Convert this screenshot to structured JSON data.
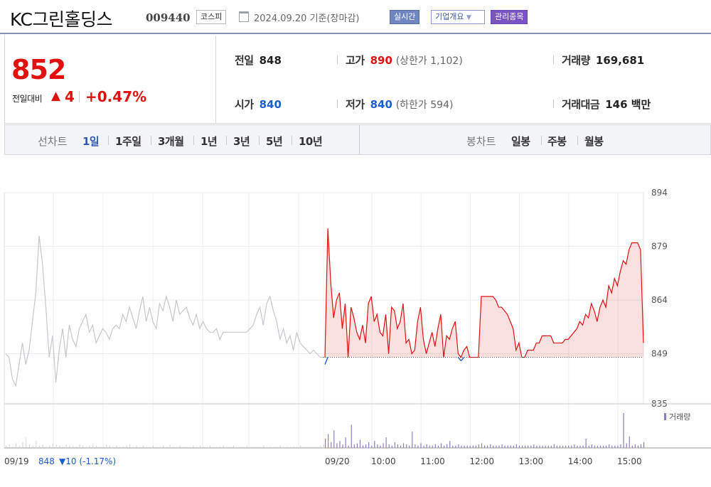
{
  "header": {
    "company_name": "KC그린홀딩스",
    "stock_code": "009440",
    "market": "코스피",
    "date_text": "2024.09.20 기준(장마감)",
    "realtime_label": "실시간",
    "company_info_label": "기업개요",
    "managed_label": "관리종목"
  },
  "quote": {
    "price": "852",
    "change_label": "전일대비",
    "change_value": "4",
    "change_pct": "+0.47%",
    "prev_close_label": "전일",
    "prev_close": "848",
    "high_label": "고가",
    "high": "890",
    "upper_limit": "(상한가 1,102)",
    "volume_label": "거래량",
    "volume": "169,681",
    "open_label": "시가",
    "open": "840",
    "low_label": "저가",
    "low": "840",
    "lower_limit": "(하한가 594)",
    "trade_value_label": "거래대금",
    "trade_value": "146 백만"
  },
  "tabs": {
    "line_chart_label": "선차트",
    "periods": [
      "1일",
      "1주일",
      "3개월",
      "1년",
      "3년",
      "5년",
      "10년"
    ],
    "selected_period": "1일",
    "candle_chart_label": "봉차트",
    "candle_periods": [
      "일봉",
      "주봉",
      "월봉"
    ]
  },
  "colors": {
    "up": "#e0110f",
    "down": "#1a5fcf",
    "prev_day_line": "#c4c7cc",
    "volume_bar": "#8e7cc3"
  },
  "chart_data": {
    "type": "line",
    "ylim": [
      835,
      894
    ],
    "yticks": [
      835,
      849,
      864,
      879,
      894
    ],
    "prev_close": 848,
    "prev_day_label": "09/19",
    "prev_day_close_text": "848",
    "prev_day_change_text": "▼10 (-1.17%)",
    "x_labels": [
      "09/20",
      "10:00",
      "11:00",
      "12:00",
      "13:00",
      "14:00",
      "15:00"
    ],
    "volume_legend": "거래량",
    "series": [
      {
        "name": "09/19",
        "values": [
          849,
          848,
          842,
          840,
          846,
          852,
          846,
          850,
          858,
          866,
          882,
          874,
          862,
          848,
          854,
          841,
          850,
          856,
          848,
          857,
          853,
          851,
          856,
          858,
          860,
          855,
          857,
          852,
          854,
          856,
          855,
          853,
          856,
          857,
          856,
          860,
          858,
          862,
          859,
          856,
          861,
          865,
          858,
          862,
          858,
          856,
          863,
          861,
          865,
          862,
          858,
          864,
          860,
          861,
          862,
          859,
          857,
          860,
          856,
          858,
          856,
          855,
          855,
          856,
          853,
          855,
          855,
          855,
          855,
          855,
          855,
          855,
          855,
          856,
          857,
          860,
          862,
          857,
          863,
          865,
          861,
          858,
          853,
          856,
          852,
          854,
          850,
          855,
          852,
          851,
          850,
          849,
          850,
          849,
          848,
          848
        ]
      },
      {
        "name": "09/20",
        "values": [
          846,
          884,
          869,
          859,
          864,
          866,
          856,
          863,
          848,
          862,
          859,
          855,
          853,
          857,
          852,
          863,
          865,
          858,
          860,
          855,
          854,
          860,
          849,
          862,
          861,
          856,
          858,
          863,
          852,
          853,
          849,
          850,
          858,
          862,
          853,
          849,
          852,
          855,
          851,
          856,
          860,
          848,
          854,
          853,
          856,
          858,
          849,
          847,
          850,
          851,
          848,
          848,
          848,
          848,
          865,
          865,
          865,
          865,
          865,
          864,
          862,
          862,
          861,
          860,
          858,
          856,
          850,
          852,
          848,
          848,
          850,
          850,
          850,
          852,
          852,
          854,
          854,
          854,
          854,
          852,
          852,
          852,
          852,
          853,
          853,
          854,
          855,
          856,
          858,
          857,
          860,
          859,
          863,
          861,
          858,
          862,
          864,
          862,
          868,
          866,
          870,
          868,
          872,
          875,
          874,
          878,
          880,
          880,
          880,
          878,
          852
        ]
      }
    ],
    "volume": {
      "prev_day": [
        2,
        3,
        1,
        4,
        2,
        5,
        9,
        3,
        2,
        6,
        2,
        3,
        1,
        2,
        4,
        3,
        2,
        1,
        3,
        2,
        2,
        1,
        3,
        2,
        1,
        2,
        4,
        2,
        1,
        1,
        3,
        2,
        1,
        2,
        1,
        1,
        2,
        3,
        1,
        2,
        1,
        2,
        1,
        1,
        2,
        1,
        1,
        2,
        1,
        3,
        1,
        1,
        2,
        1,
        1,
        1,
        2,
        1,
        2,
        1,
        1,
        2,
        1,
        1,
        1,
        2,
        1,
        1,
        2,
        1,
        1,
        1,
        2,
        1,
        1,
        1,
        1,
        2,
        1,
        1,
        1,
        1,
        2,
        1,
        1,
        1,
        1,
        1,
        2,
        1,
        1,
        1,
        1,
        1,
        2,
        3
      ],
      "today": [
        8,
        12,
        5,
        15,
        4,
        6,
        3,
        9,
        2,
        20,
        3,
        4,
        7,
        2,
        3,
        5,
        2,
        6,
        3,
        2,
        4,
        9,
        3,
        2,
        5,
        3,
        2,
        4,
        3,
        2,
        14,
        3,
        2,
        4,
        2,
        3,
        2,
        2,
        3,
        2,
        4,
        2,
        3,
        6,
        2,
        2,
        3,
        2,
        2,
        2,
        2,
        2,
        2,
        3,
        4,
        2,
        2,
        3,
        2,
        2,
        2,
        3,
        2,
        2,
        2,
        2,
        3,
        2,
        2,
        2,
        2,
        2,
        3,
        2,
        2,
        2,
        2,
        2,
        2,
        3,
        2,
        2,
        2,
        2,
        2,
        2,
        3,
        2,
        2,
        2,
        8,
        2,
        3,
        2,
        2,
        2,
        2,
        2,
        3,
        2,
        2,
        2,
        3,
        30,
        4,
        10,
        2,
        3,
        2,
        3,
        5
      ]
    }
  }
}
